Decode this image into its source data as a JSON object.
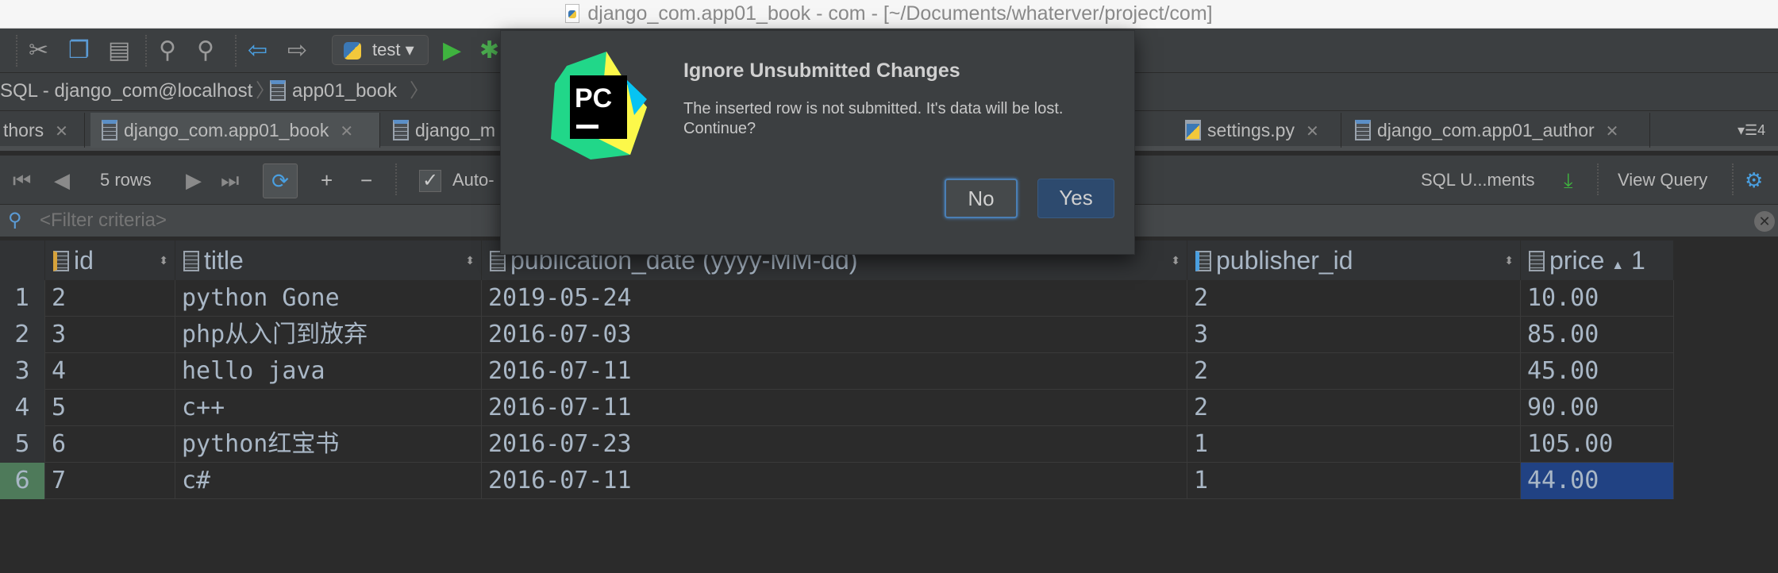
{
  "window": {
    "title": "django_com.app01_book - com - [~/Documents/whaterver/project/com]"
  },
  "toolbar": {
    "run_config": "test"
  },
  "breadcrumb": [
    "SQL - django_com@localhost",
    "app01_book"
  ],
  "tabs": [
    {
      "label": "thors",
      "active": false
    },
    {
      "label": "django_com.app01_book",
      "active": true
    },
    {
      "label": "django_m",
      "active": false
    },
    {
      "label": "settings.py",
      "active": false
    },
    {
      "label": "django_com.app01_author",
      "active": false
    }
  ],
  "tabs_overflow": "4",
  "data_toolbar": {
    "row_count": "5 rows",
    "auto_commit": "Auto-",
    "auto_commit_checked": true,
    "sql_docs": "SQL U...ments",
    "view_query": "View Query"
  },
  "filter": {
    "placeholder": "<Filter criteria>"
  },
  "table": {
    "columns": [
      "id",
      "title",
      "publication_date (yyyy-MM-dd)",
      "publisher_id",
      "price"
    ],
    "sort_indicator": "1",
    "rows": [
      {
        "n": "1",
        "id": "2",
        "title": "python Gone",
        "date": "2019-05-24",
        "publisher_id": "2",
        "price": "10.00"
      },
      {
        "n": "2",
        "id": "3",
        "title": "php从入门到放弃",
        "date": "2016-07-03",
        "publisher_id": "3",
        "price": "85.00"
      },
      {
        "n": "3",
        "id": "4",
        "title": "hello java",
        "date": "2016-07-11",
        "publisher_id": "2",
        "price": "45.00"
      },
      {
        "n": "4",
        "id": "5",
        "title": "c++",
        "date": "2016-07-11",
        "publisher_id": "2",
        "price": "90.00"
      },
      {
        "n": "5",
        "id": "6",
        "title": "python红宝书",
        "date": "2016-07-23",
        "publisher_id": "1",
        "price": "105.00"
      },
      {
        "n": "6",
        "id": "7",
        "title": "c#",
        "date": "2016-07-11",
        "publisher_id": "1",
        "price": "44.00"
      }
    ],
    "selected_row": 6
  },
  "dialog": {
    "title": "Ignore Unsubmitted Changes",
    "message": "The inserted row is not submitted. It's data will be lost. Continue?",
    "no": "No",
    "yes": "Yes",
    "logo_text": "PC"
  },
  "colors": {
    "selection": "#214283",
    "selected_row_number": "#4e7a5a",
    "accent": "#4a88c7"
  }
}
